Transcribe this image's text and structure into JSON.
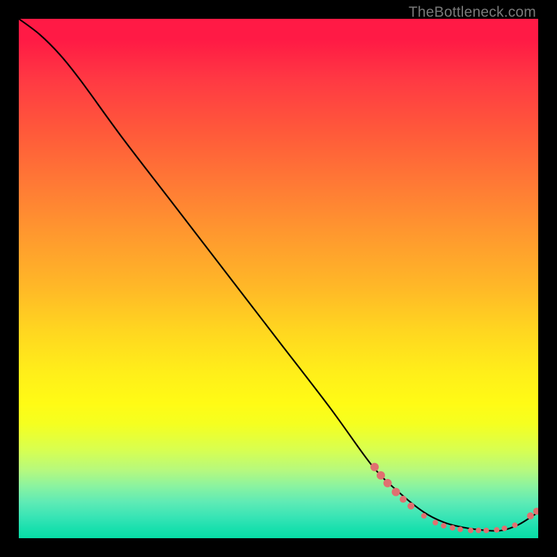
{
  "watermark": "TheBottleneck.com",
  "chart_data": {
    "type": "line",
    "title": "",
    "xlabel": "",
    "ylabel": "",
    "xlim": [
      0,
      100
    ],
    "ylim": [
      0,
      100
    ],
    "grid": false,
    "line_color": "#000000",
    "marker_color": "#e07070",
    "series": [
      {
        "name": "curve",
        "x": [
          0,
          4,
          8,
          12,
          20,
          30,
          40,
          50,
          60,
          68,
          73,
          78,
          82,
          86,
          90,
          93,
          96,
          98.5,
          100
        ],
        "y": [
          100,
          97,
          93,
          88,
          77,
          64,
          51,
          38,
          25,
          14,
          9,
          5,
          3,
          2,
          1.5,
          1.5,
          2.5,
          4,
          5
        ]
      }
    ],
    "markers": [
      {
        "x": 68.5,
        "y": 13.7,
        "r": 6
      },
      {
        "x": 69.7,
        "y": 12.1,
        "r": 6
      },
      {
        "x": 71.0,
        "y": 10.6,
        "r": 6
      },
      {
        "x": 72.6,
        "y": 8.9,
        "r": 6
      },
      {
        "x": 74.0,
        "y": 7.5,
        "r": 5
      },
      {
        "x": 75.5,
        "y": 6.2,
        "r": 5
      },
      {
        "x": 78.0,
        "y": 4.3,
        "r": 4
      },
      {
        "x": 80.2,
        "y": 3.0,
        "r": 4
      },
      {
        "x": 81.8,
        "y": 2.4,
        "r": 4
      },
      {
        "x": 83.5,
        "y": 2.0,
        "r": 4
      },
      {
        "x": 85.0,
        "y": 1.7,
        "r": 4
      },
      {
        "x": 87.0,
        "y": 1.5,
        "r": 4
      },
      {
        "x": 88.5,
        "y": 1.5,
        "r": 4
      },
      {
        "x": 90.0,
        "y": 1.5,
        "r": 4
      },
      {
        "x": 92.0,
        "y": 1.6,
        "r": 4
      },
      {
        "x": 93.5,
        "y": 1.9,
        "r": 4
      },
      {
        "x": 95.5,
        "y": 2.5,
        "r": 4
      },
      {
        "x": 98.5,
        "y": 4.3,
        "r": 5
      },
      {
        "x": 99.7,
        "y": 5.2,
        "r": 5
      }
    ]
  }
}
